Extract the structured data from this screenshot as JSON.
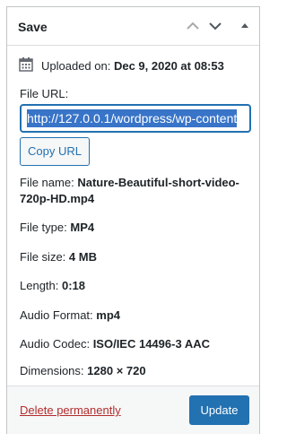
{
  "panel": {
    "title": "Save",
    "buttons": [
      {
        "icon": "chevron-up-icon"
      },
      {
        "icon": "chevron-down-icon"
      },
      {
        "icon": "caret-up-icon"
      }
    ]
  },
  "uploaded": {
    "icon": "calendar-icon",
    "label": "Uploaded on:",
    "value": "Dec 9, 2020 at 08:53"
  },
  "file_url": {
    "label": "File URL:",
    "value": "http://127.0.0.1/wordpress/wp-content"
  },
  "copy_button": "Copy URL",
  "meta": {
    "file_name_label": "File name:",
    "file_name_line1": "Nature-Beautiful-short-video-",
    "file_name_line2": "720p-HD.mp4",
    "file_type_label": "File type:",
    "file_type_value": "MP4",
    "file_size_label": "File size:",
    "file_size_value": "4 MB",
    "length_label": "Length:",
    "length_value": "0:18",
    "audio_format_label": "Audio Format:",
    "audio_format_value": "mp4",
    "audio_codec_label": "Audio Codec:",
    "audio_codec_value": "ISO/IEC 14496-3 AAC",
    "dimensions_label": "Dimensions:",
    "dimensions_value": "1280 × 720"
  },
  "footer": {
    "delete_label": "Delete permanently",
    "update_label": "Update"
  },
  "colors": {
    "accent": "#2271b1",
    "danger": "#b32d2e",
    "border": "#c3c4c7"
  }
}
